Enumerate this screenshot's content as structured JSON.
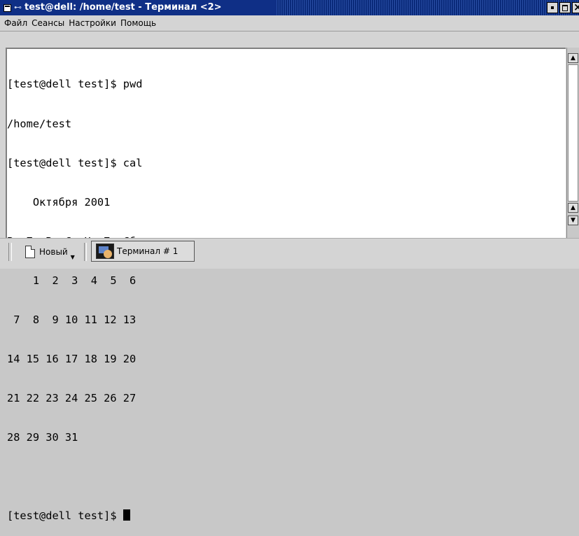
{
  "window": {
    "title": "test@dell: /home/test - Терминал <2>",
    "pin_glyph": "⊷"
  },
  "menubar": {
    "items": [
      "Файл",
      "Сеансы",
      "Настройки",
      "Помощь"
    ]
  },
  "terminal": {
    "lines": [
      "[test@dell test]$ pwd",
      "/home/test",
      "[test@dell test]$ cal",
      "    Октября 2001",
      "Вс Пн Вт Ср Чт Пт Сб",
      "    1  2  3  4  5  6",
      " 7  8  9 10 11 12 13",
      "14 15 16 17 18 19 20",
      "21 22 23 24 25 26 27",
      "28 29 30 31",
      "",
      "[test@dell test]$ "
    ]
  },
  "tabbar": {
    "new_label": "Новый",
    "terminal_tab_label": "Терминал # 1"
  },
  "icons": {
    "window_menu": "window-menu-icon",
    "new_session": "document-icon",
    "terminal_tab": "terminal-icon"
  }
}
